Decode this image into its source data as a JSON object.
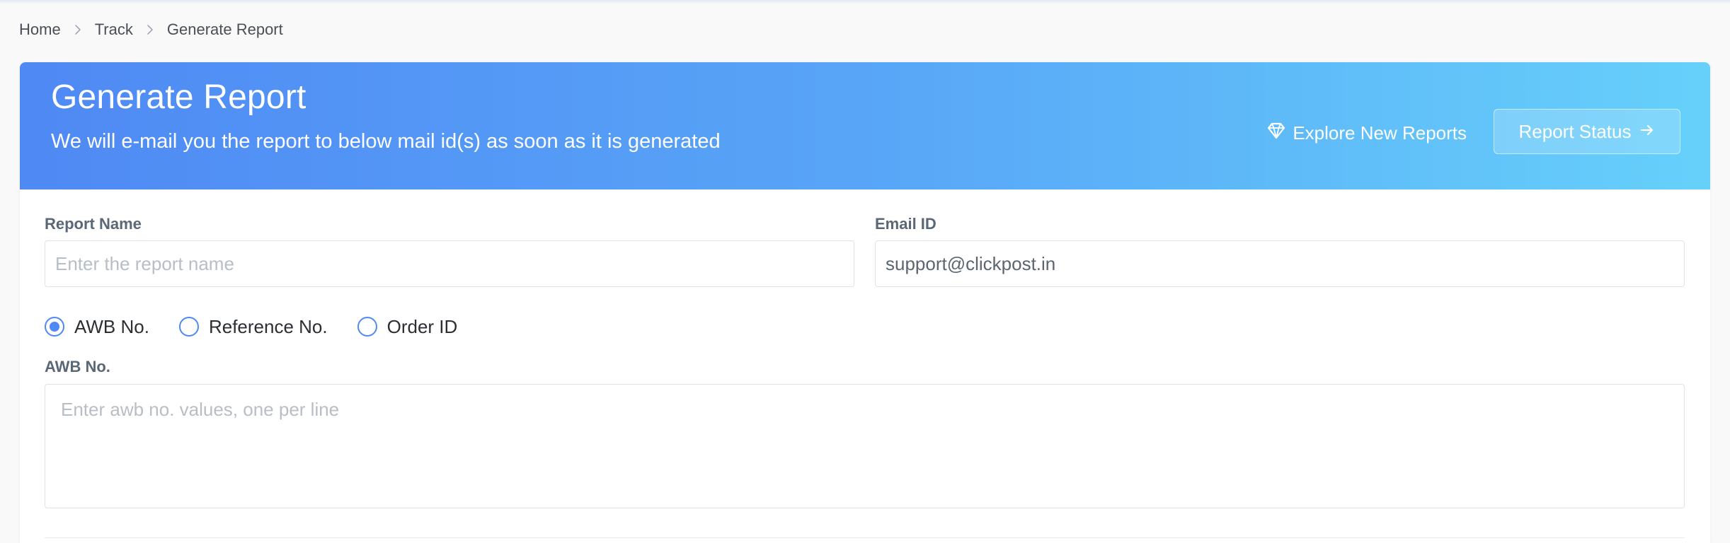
{
  "breadcrumb": {
    "items": [
      "Home",
      "Track",
      "Generate Report"
    ]
  },
  "banner": {
    "title": "Generate Report",
    "subtitle": "We will e-mail you the report to below mail id(s) as soon as it is generated",
    "explore_label": "Explore New Reports",
    "explore_icon": "diamond-icon",
    "status_button_label": "Report Status",
    "status_button_icon": "arrow-right-icon",
    "gradient_colors": [
      "#4f89f4",
      "#66d0fa"
    ]
  },
  "form": {
    "report_name": {
      "label": "Report Name",
      "placeholder": "Enter the report name",
      "value": ""
    },
    "email": {
      "label": "Email ID",
      "value": "support@clickpost.in"
    },
    "id_type": {
      "options": [
        "AWB No.",
        "Reference No.",
        "Order ID"
      ],
      "selected": "AWB No."
    },
    "values_field": {
      "label": "AWB No.",
      "placeholder": "Enter awb no. values, one per line",
      "value": ""
    }
  },
  "colors": {
    "accent": "#4f89f4",
    "page_background": "#f9f9fa"
  }
}
